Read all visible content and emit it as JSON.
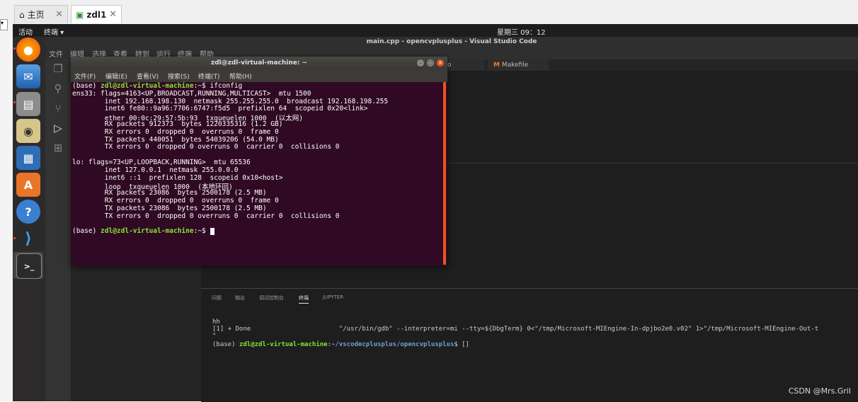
{
  "host": {
    "tabs": [
      {
        "label": "主页",
        "close": "✕"
      },
      {
        "label": "zdl1",
        "close": "✕"
      }
    ]
  },
  "topbar": {
    "activities": "活动",
    "app": "终端 ▾",
    "clock": "星期三 09：12"
  },
  "vscode": {
    "title": "main.cpp - opencvplusplus - Visual Studio Code",
    "menu": [
      "文件",
      "编辑",
      "选择",
      "查看",
      "转到",
      "运行",
      "终端",
      "帮助"
    ],
    "tabs": [
      "o",
      "Makefile"
    ],
    "panel_tabs": [
      "问题",
      "输出",
      "调试控制台",
      "终端",
      "JUPYTER"
    ],
    "panel_lines": [
      "hh",
      "[1] + Done                       \"/usr/bin/gdb\" --interpreter=mi --tty=${DbgTerm} 0<\"/tmp/Microsoft-MIEngine-In-dpjbo2e0.v02\" 1>\"/tmp/Microsoft-MIEngine-Out-t",
      "\""
    ],
    "panel_prompt": {
      "base": "(base) ",
      "user": "zdl@zdl-virtual-machine",
      "path": ":~/vscodecplusplus/opencvplusplus",
      "end": "$ []"
    }
  },
  "terminal": {
    "title": "zdl@zdl-virtual-machine: ~",
    "menu": [
      "文件(F)",
      "编辑(E)",
      "查看(V)",
      "搜索(S)",
      "终端(T)",
      "帮助(H)"
    ],
    "prompt_base": "(base) ",
    "prompt_user": "zdl@zdl-virtual-machine",
    "prompt_tail": ":~$ ",
    "command": "ifconfig",
    "output": [
      "ens33: flags=4163<UP,BROADCAST,RUNNING,MULTICAST>  mtu 1500",
      "        inet 192.168.198.130  netmask 255.255.255.0  broadcast 192.168.198.255",
      "        inet6 fe80::9a96:7706:6747:f5d5  prefixlen 64  scopeid 0x20<link>",
      "        ether 00:0c:29:57:5b:93  txqueuelen 1000  (以太网)",
      "        RX packets 912373  bytes 1220335316 (1.2 GB)",
      "        RX errors 0  dropped 0  overruns 0  frame 0",
      "        TX packets 440051  bytes 54039206 (54.0 MB)",
      "        TX errors 0  dropped 0 overruns 0  carrier 0  collisions 0",
      "",
      "lo: flags=73<UP,LOOPBACK,RUNNING>  mtu 65536",
      "        inet 127.0.0.1  netmask 255.0.0.0",
      "        inet6 ::1  prefixlen 128  scopeid 0x10<host>",
      "        loop  txqueuelen 1000  (本地环回)",
      "        RX packets 23086  bytes 2500178 (2.5 MB)",
      "        RX errors 0  dropped 0  overruns 0  frame 0",
      "        TX packets 23086  bytes 2500178 (2.5 MB)",
      "        TX errors 0  dropped 0 overruns 0  carrier 0  collisions 0",
      ""
    ]
  },
  "watermark": "CSDN @Mrs.Gril",
  "colors": {
    "terminal_bg": "#300a24",
    "accent": "#e95420",
    "prompt_green": "#8ae234",
    "prompt_blue": "#729fcf"
  }
}
